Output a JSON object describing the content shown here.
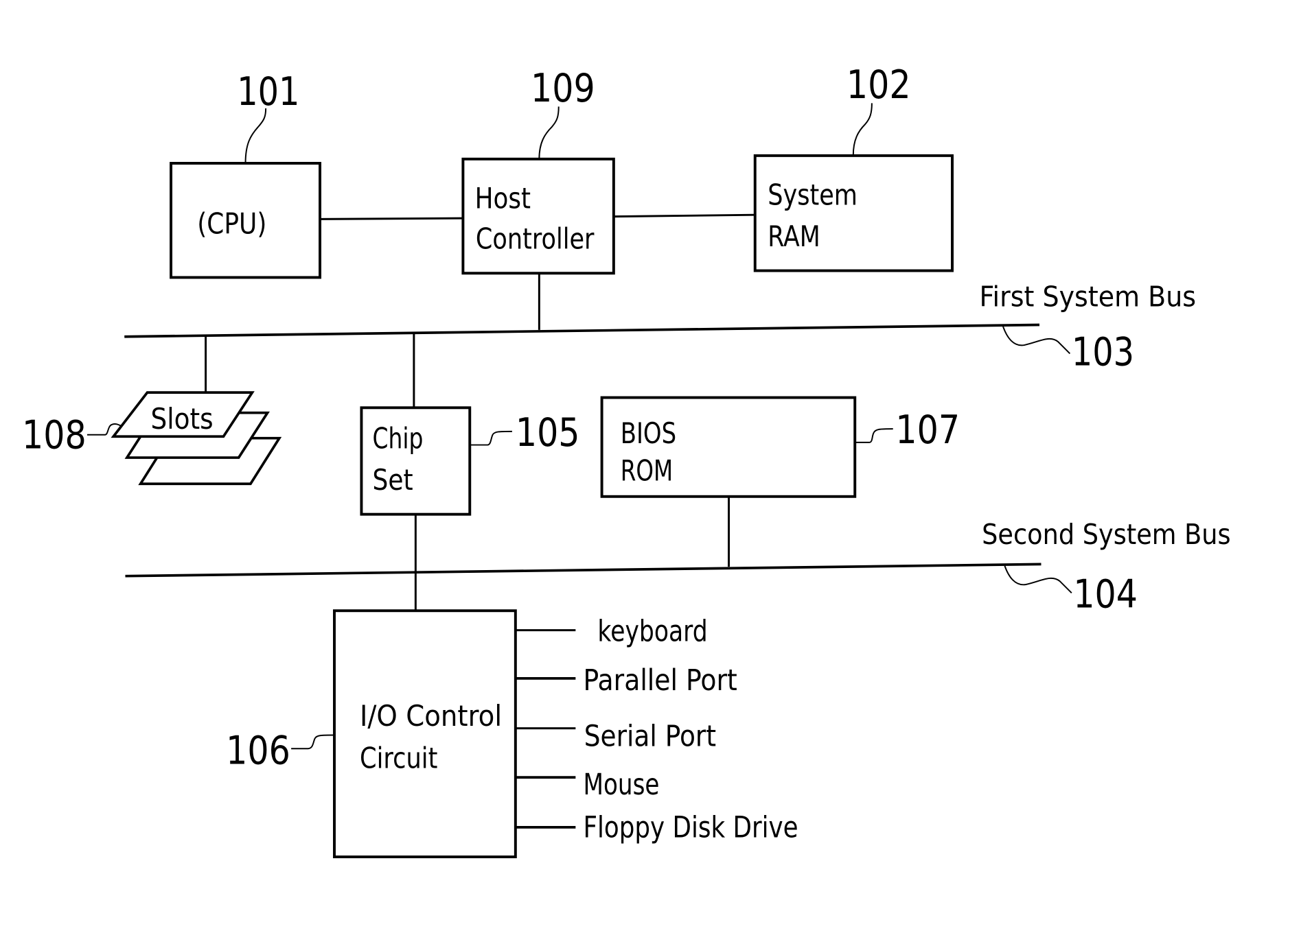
{
  "diagram": {
    "type": "computer system block diagram",
    "components": {
      "cpu": {
        "ref": "101",
        "label_lines": [
          "(CPU)"
        ]
      },
      "host_controller": {
        "ref": "109",
        "label_lines": [
          "Host",
          "Controller"
        ]
      },
      "system_ram": {
        "ref": "102",
        "label_lines": [
          "System",
          "RAM"
        ]
      },
      "chip_set": {
        "ref": "105",
        "label_lines": [
          "Chip",
          "Set"
        ]
      },
      "bios_rom": {
        "ref": "107",
        "label_lines": [
          "BIOS",
          "ROM"
        ]
      },
      "io_control": {
        "ref": "106",
        "label_lines": [
          "I/O Control",
          "Circuit"
        ]
      },
      "slots": {
        "ref": "108",
        "label": "Slots"
      }
    },
    "buses": {
      "first": {
        "ref": "103",
        "label": "First System Bus"
      },
      "second": {
        "ref": "104",
        "label": "Second System Bus"
      }
    },
    "io_ports": [
      "keyboard",
      "Parallel Port",
      "Serial Port",
      "Mouse",
      "Floppy Disk Drive"
    ],
    "connections": [
      [
        "cpu",
        "host_controller"
      ],
      [
        "host_controller",
        "system_ram"
      ],
      [
        "host_controller",
        "first_bus"
      ],
      [
        "slots",
        "first_bus"
      ],
      [
        "chip_set",
        "first_bus"
      ],
      [
        "chip_set",
        "second_bus"
      ],
      [
        "bios_rom",
        "second_bus"
      ],
      [
        "io_control",
        "second_bus"
      ],
      [
        "io_control",
        "keyboard"
      ],
      [
        "io_control",
        "Parallel Port"
      ],
      [
        "io_control",
        "Serial Port"
      ],
      [
        "io_control",
        "Mouse"
      ],
      [
        "io_control",
        "Floppy Disk Drive"
      ]
    ]
  }
}
